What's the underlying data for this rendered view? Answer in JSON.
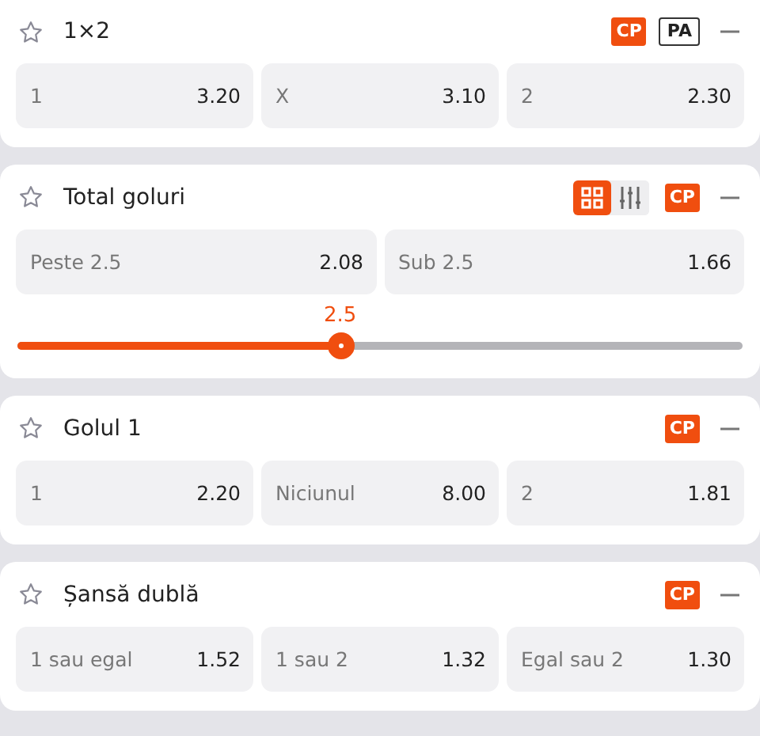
{
  "markets": [
    {
      "title": "1×2",
      "badges": [
        {
          "label": "CP",
          "kind": "filled"
        },
        {
          "label": "PA",
          "kind": "outline"
        }
      ],
      "odds": [
        {
          "label": "1",
          "value": "3.20"
        },
        {
          "label": "X",
          "value": "3.10"
        },
        {
          "label": "2",
          "value": "2.30"
        }
      ]
    },
    {
      "title": "Total goluri",
      "views": [
        {
          "kind": "grid",
          "selected": true
        },
        {
          "kind": "sliders",
          "selected": false
        }
      ],
      "badges": [
        {
          "label": "CP",
          "kind": "filled"
        }
      ],
      "odds": [
        {
          "label": "Peste 2.5",
          "value": "2.08"
        },
        {
          "label": "Sub 2.5",
          "value": "1.66"
        }
      ],
      "slider": {
        "reading": "2.5",
        "level": 0.445
      }
    },
    {
      "title": "Golul 1",
      "badges": [
        {
          "label": "CP",
          "kind": "filled"
        }
      ],
      "odds": [
        {
          "label": "1",
          "value": "2.20"
        },
        {
          "label": "Niciunul",
          "value": "8.00"
        },
        {
          "label": "2",
          "value": "1.81"
        }
      ]
    },
    {
      "title": "Șansă dublă",
      "badges": [
        {
          "label": "CP",
          "kind": "filled"
        }
      ],
      "odds": [
        {
          "label": "1 sau egal",
          "value": "1.52"
        },
        {
          "label": "1 sau 2",
          "value": "1.32"
        },
        {
          "label": "Egal sau 2",
          "value": "1.30"
        }
      ]
    }
  ]
}
